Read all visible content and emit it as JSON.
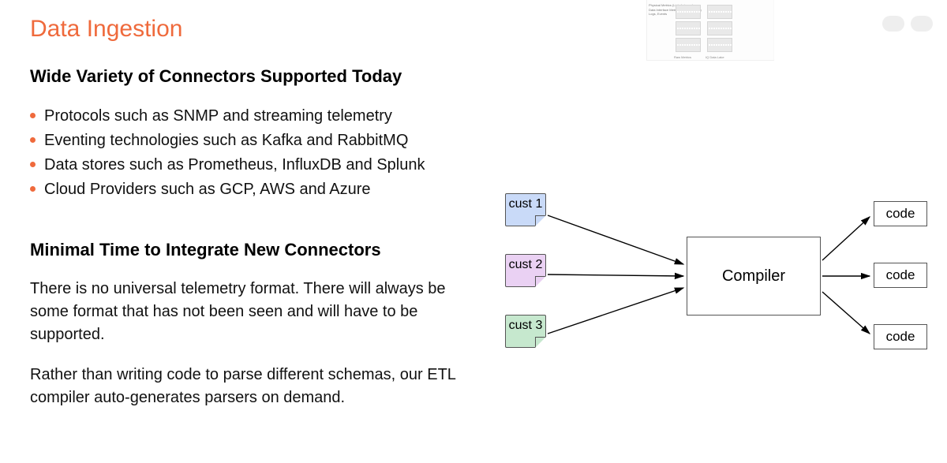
{
  "title": "Data Ingestion",
  "section1": {
    "heading": "Wide Variety of Connectors Supported Today",
    "bullets": [
      "Protocols such as SNMP and streaming telemetry",
      "Eventing technologies such as Kafka and RabbitMQ",
      "Data stores such as Prometheus, InfluxDB and Splunk",
      "Cloud Providers such as GCP, AWS and Azure"
    ]
  },
  "section2": {
    "heading": "Minimal Time to Integrate New Connectors",
    "para1": "There is no universal telemetry format. There will always be some format that has not been seen and will have to be supported.",
    "para2": "Rather than writing code to parse different schemas, our ETL compiler auto-generates parsers on demand."
  },
  "diagram": {
    "inputs": [
      "cust 1",
      "cust 2",
      "cust 3"
    ],
    "center": "Compiler",
    "outputs": [
      "code",
      "code",
      "code"
    ]
  },
  "thumbnail": {
    "row_labels": [
      "Physical Metrics (Link, Latency)",
      "Data Interface Metrics (Drops, Errors)",
      "Logs, Events"
    ],
    "col_labels": [
      "Raw Metrics",
      "IQ Data Lake"
    ]
  }
}
